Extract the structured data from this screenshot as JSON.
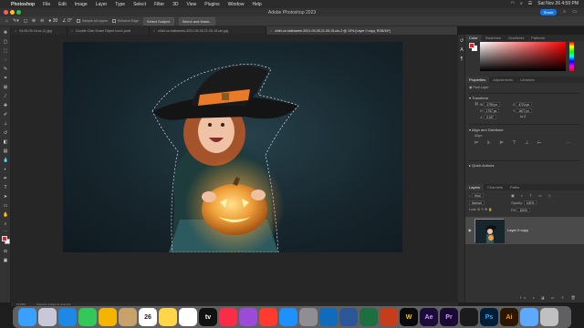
{
  "menubar": {
    "app": "Photoshop",
    "items": [
      "File",
      "Edit",
      "Image",
      "Layer",
      "Type",
      "Select",
      "Filter",
      "3D",
      "View",
      "Plugins",
      "Window",
      "Help"
    ],
    "datetime": "Sat Nov 26  4:59 PM"
  },
  "window": {
    "title": "Adobe Photoshop 2023",
    "share_label": "Share"
  },
  "options_bar": {
    "sample_all_layers": "Sample All Layers",
    "enhance_edge": "Enhance Edge",
    "select_subject": "Select Subject",
    "select_and_mask": "Select and Mask..."
  },
  "doc_tabs": [
    {
      "label": "04-05-09-16-sc (1).jpg",
      "active": false
    },
    {
      "label": "Double Click Smart Object Icon1.psdt",
      "active": false
    },
    {
      "label": "child-on-halloween-2021-09-28-21-05-15-utc.jpg",
      "active": false
    },
    {
      "label": "child-on-halloween-2021-09-28-21-05-15-utc-2 @ 13% (Layer 0 copy, RGB/16*)",
      "active": true
    }
  ],
  "status_bar": {
    "zoom": "12.68%",
    "info": "Saved to a layer to view info"
  },
  "color_panel": {
    "tabs": [
      "Color",
      "Swatches",
      "Gradients",
      "Patterns"
    ],
    "foreground": "#e3202a",
    "background": "#ffffff"
  },
  "properties": {
    "tabs": [
      "Properties",
      "Adjustments",
      "Libraries"
    ],
    "kind": "Pixel Layer",
    "transform_label": "Transform",
    "w": "2790 px",
    "h": "1797 px",
    "x": "4724 px",
    "y": "1677 px",
    "angle": "0.00°",
    "align_label": "Align and Distribute",
    "align_sub": "Align:",
    "quick_actions": "Quick Actions"
  },
  "layers_panel": {
    "tabs": [
      "Layers",
      "Channels",
      "Paths"
    ],
    "search_placeholder": "Kind",
    "blend_mode": "Normal",
    "opacity_label": "Opacity:",
    "opacity": "100%",
    "lock_label": "Lock:",
    "fill_label": "Fill:",
    "fill": "100%",
    "layers": [
      {
        "name": "Layer 0 copy",
        "visible": true,
        "selected": true
      }
    ]
  },
  "dock": {
    "apps": [
      "finder",
      "launchpad",
      "safari",
      "messages",
      "photos",
      "contacts",
      "calendar",
      "notes",
      "reminders",
      "tv",
      "music",
      "podcasts",
      "news",
      "app-store",
      "system-settings",
      "outlook",
      "word",
      "excel",
      "powerpoint",
      "webex",
      "after-effects",
      "premiere",
      "terminal",
      "photoshop",
      "illustrator",
      "folder",
      "trash"
    ],
    "calendar_day": "26",
    "calendar_month": "NOV",
    "ae_label": "Ae",
    "pr_label": "Pr",
    "ps_label": "Ps",
    "ai_label": "Ai",
    "w_label": "W",
    "tv_label": "tv"
  }
}
